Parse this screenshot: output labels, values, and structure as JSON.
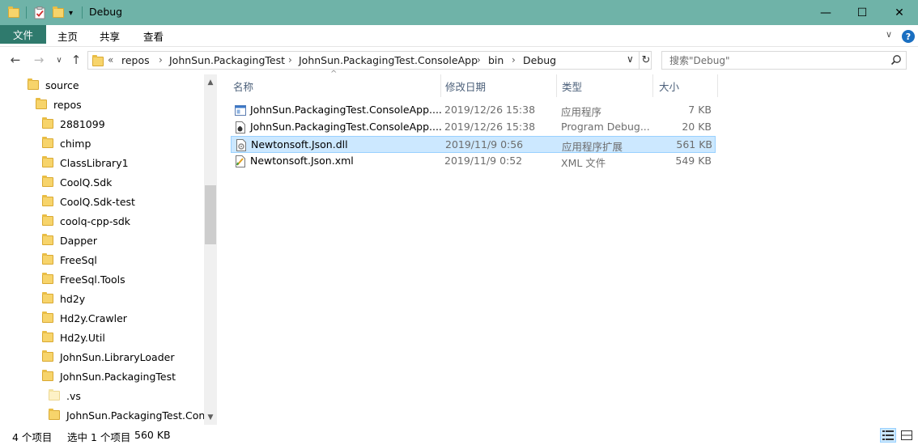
{
  "window": {
    "title": "Debug",
    "minimize_glyph": "—",
    "maximize_glyph": "☐",
    "close_glyph": "✕"
  },
  "quick_access": {
    "dropdown_glyph": "▾"
  },
  "ribbon": {
    "tabs": [
      "文件",
      "主页",
      "共享",
      "查看"
    ],
    "expand_glyph": "∨",
    "help_glyph": "?"
  },
  "address": {
    "back_glyph": "←",
    "forward_glyph": "→",
    "recent_glyph": "∨",
    "up_glyph": "↑",
    "overflow_glyph": "«",
    "crumbs": [
      "repos",
      "JohnSun.PackagingTest",
      "JohnSun.PackagingTest.ConsoleApp",
      "bin",
      "Debug"
    ],
    "crumb_sep_glyph": "›",
    "dropdown_glyph": "∨",
    "refresh_glyph": "↻"
  },
  "search": {
    "placeholder": "搜索\"Debug\""
  },
  "nav_tree": {
    "items": [
      {
        "label": "source",
        "level": 0
      },
      {
        "label": "repos",
        "level": 1
      },
      {
        "label": "2881099",
        "level": 2
      },
      {
        "label": "chimp",
        "level": 2
      },
      {
        "label": "ClassLibrary1",
        "level": 2
      },
      {
        "label": "CoolQ.Sdk",
        "level": 2
      },
      {
        "label": "CoolQ.Sdk-test",
        "level": 2
      },
      {
        "label": "coolq-cpp-sdk",
        "level": 2
      },
      {
        "label": "Dapper",
        "level": 2
      },
      {
        "label": "FreeSql",
        "level": 2
      },
      {
        "label": "FreeSql.Tools",
        "level": 2
      },
      {
        "label": "hd2y",
        "level": 2
      },
      {
        "label": "Hd2y.Crawler",
        "level": 2
      },
      {
        "label": "Hd2y.Util",
        "level": 2
      },
      {
        "label": "JohnSun.LibraryLoader",
        "level": 2
      },
      {
        "label": "JohnSun.PackagingTest",
        "level": 2
      },
      {
        "label": ".vs",
        "level": 3
      },
      {
        "label": "JohnSun.PackagingTest.Consc",
        "level": 3
      }
    ],
    "scroll_up_glyph": "▲",
    "scroll_down_glyph": "▼"
  },
  "columns": {
    "name": "名称",
    "modified": "修改日期",
    "type": "类型",
    "size": "大小",
    "sort_glyph": "^"
  },
  "files": [
    {
      "name": "JohnSun.PackagingTest.ConsoleApp....",
      "modified": "2019/12/26 15:38",
      "type": "应用程序",
      "size": "7 KB",
      "icon": "exe-icon",
      "selected": false
    },
    {
      "name": "JohnSun.PackagingTest.ConsoleApp....",
      "modified": "2019/12/26 15:38",
      "type": "Program Debug...",
      "size": "20 KB",
      "icon": "pdb-icon",
      "selected": false
    },
    {
      "name": "Newtonsoft.Json.dll",
      "modified": "2019/11/9 0:56",
      "type": "应用程序扩展",
      "size": "561 KB",
      "icon": "dll-icon",
      "selected": true
    },
    {
      "name": "Newtonsoft.Json.xml",
      "modified": "2019/11/9 0:52",
      "type": "XML 文件",
      "size": "549 KB",
      "icon": "xml-icon",
      "selected": false
    }
  ],
  "status": {
    "item_count": "4 个项目",
    "selection": "选中 1 个项目",
    "selection_size": "560 KB"
  },
  "colors": {
    "titlebar": "#6fb3a8",
    "file_tab": "#2f7a6d",
    "selection": "#cce8ff",
    "folder": "#f7d46b"
  }
}
